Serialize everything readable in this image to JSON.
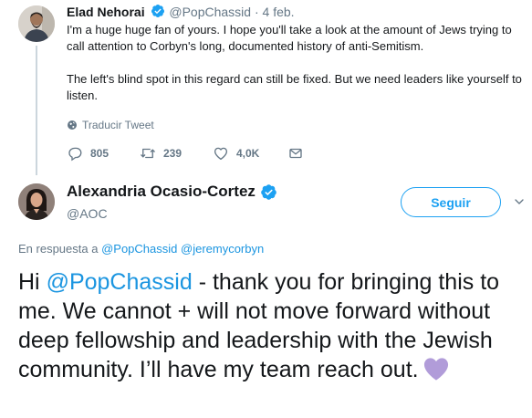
{
  "parent_tweet": {
    "author_name": "Elad Nehorai",
    "author_handle": "@PopChassid",
    "date": "4 feb.",
    "separator": "·",
    "paragraph1": "I'm a huge huge fan of yours. I hope you'll take a look at the amount of Jews trying to call attention to Corbyn's long, documented history of anti-Semitism.",
    "paragraph2": "The left's blind spot in this regard can still be fixed. But we need leaders like yourself to listen.",
    "translate_label": "Traducir Tweet",
    "replies": "805",
    "retweets": "239",
    "likes": "4,0K"
  },
  "main_tweet": {
    "author_name": "Alexandria Ocasio-Cortez",
    "author_handle": "@AOC",
    "follow_label": "Seguir",
    "reply_prefix": "En respuesta a",
    "reply_to_1": "@PopChassid",
    "reply_to_2": "@jeremycorbyn",
    "text_before": "Hi ",
    "mention": "@PopChassid",
    "text_after": " - thank you for bringing this to me. We cannot + will not move forward without deep fellowship and leadership with the Jewish community. I’ll have my team reach out."
  },
  "colors": {
    "link": "#1b95e0",
    "verified": "#1da1f2",
    "secondary_text": "#657786",
    "heart": "#b19cd9"
  },
  "icons": {
    "reply": "reply-icon",
    "retweet": "retweet-icon",
    "like": "heart-outline-icon",
    "dm": "envelope-icon",
    "translate": "globe-icon",
    "verified": "verified-badge-icon",
    "menu": "chevron-down-icon",
    "emoji": "purple-heart-icon"
  }
}
